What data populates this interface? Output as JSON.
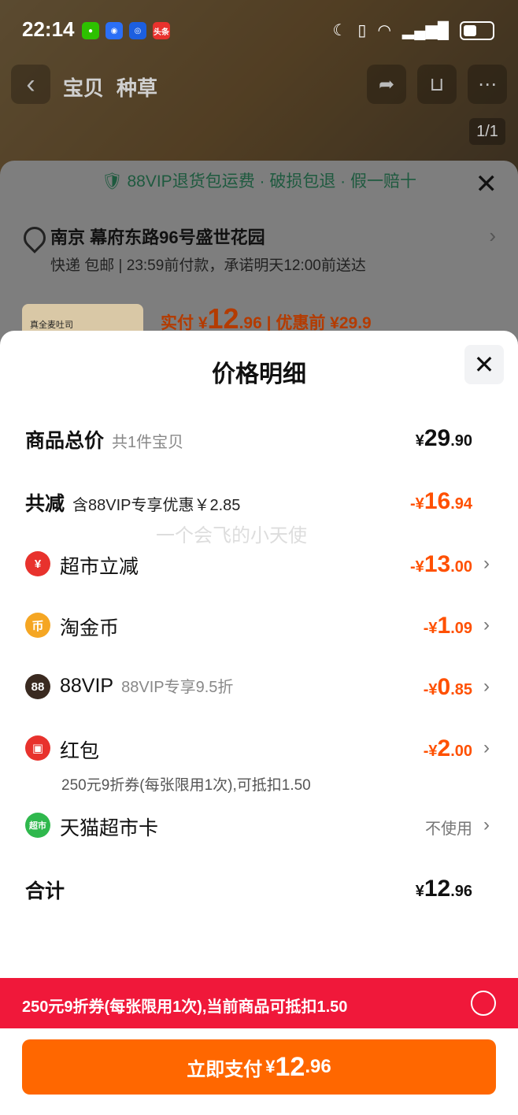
{
  "status": {
    "time": "22:14",
    "apps": [
      {
        "name": "wechat-icon",
        "glyph": "",
        "color": "#2dc100"
      },
      {
        "name": "app-blue-icon",
        "glyph": "",
        "color": "#2b6ff6"
      },
      {
        "name": "app-blue2-icon",
        "glyph": "",
        "color": "#1c5fe0"
      },
      {
        "name": "toutiao-icon",
        "glyph": "头条",
        "color": "#e8322d"
      }
    ]
  },
  "nav": {
    "back_icon": "‹",
    "tab_item": "宝贝",
    "tab_review": "种草",
    "share_icon": "➦",
    "cart_icon": "🛒",
    "page_indicator": "1/1"
  },
  "background_sheet": {
    "vip_banner": "88VIP退货包运费 · 破损包退 · 假一赔十",
    "address": "南京 幕府东路96号盛世花园",
    "delivery": "快递 包邮 | 23:59前付款，承诺明天12:00前送达",
    "product_thumb": "真全麦吐司",
    "paid_label": "实付",
    "paid_yen": "¥",
    "paid_int": "12",
    "paid_dec": ".96",
    "before_label": "| 优惠前 ¥29.9"
  },
  "modal": {
    "title": "价格明细",
    "close_icon": "✕",
    "total_goods": {
      "label": "商品总价",
      "sub": "共1件宝贝",
      "yen": "¥",
      "int": "29",
      "dec": ".90"
    },
    "total_discount": {
      "label": "共减",
      "sub": "含88VIP专享优惠￥2.85",
      "yen": "-¥",
      "int": "16",
      "dec": ".94"
    },
    "items": [
      {
        "icon": "¥",
        "icon_color": "#e8322d",
        "label": "超市立减",
        "sub": "",
        "yen": "-¥",
        "int": "13",
        "dec": ".00"
      },
      {
        "icon": "币",
        "icon_color": "#f5a623",
        "label": "淘金币",
        "sub": "",
        "yen": "-¥",
        "int": "1",
        "dec": ".09"
      },
      {
        "icon": "88",
        "icon_color": "#3a2a20",
        "label": "88VIP",
        "sub": "88VIP专享9.5折",
        "yen": "-¥",
        "int": "0",
        "dec": ".85"
      },
      {
        "icon": "▣",
        "icon_color": "#e8322d",
        "label": "红包",
        "sub": "",
        "yen": "-¥",
        "int": "2",
        "dec": ".00",
        "note": "250元9折券(每张限用1次),可抵扣1.50"
      }
    ],
    "supermarket_card": {
      "icon": "超市",
      "icon_color": "#2fb84d",
      "label": "天猫超市卡",
      "value": "不使用"
    },
    "total": {
      "label": "合计",
      "yen": "¥",
      "int": "12",
      "dec": ".96"
    },
    "watermark": "一个会飞的小天使",
    "chevron": "›"
  },
  "coupon_bar": {
    "text": "250元9折券(每张限用1次),当前商品可抵扣1.50"
  },
  "pay_button": {
    "label": "立即支付",
    "yen": "¥",
    "int": "12",
    "dec": ".96"
  },
  "colors": {
    "accent_orange": "#ff5000",
    "pay_button": "#ff6700",
    "coupon_red": "#f0183a"
  }
}
